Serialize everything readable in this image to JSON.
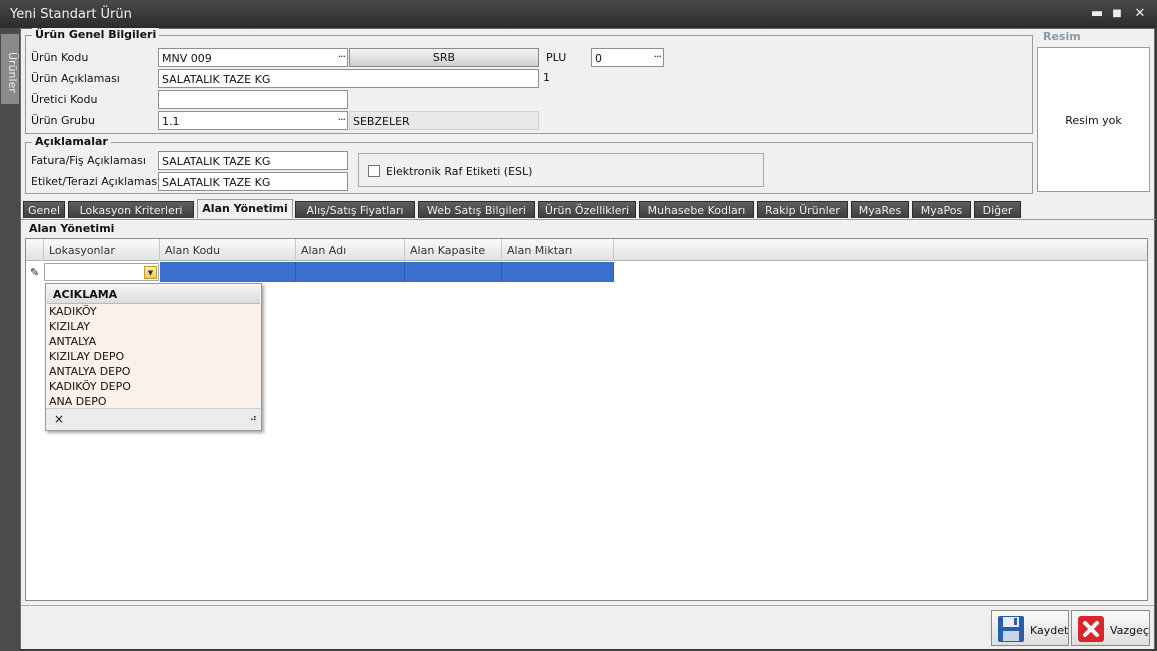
{
  "window": {
    "title": "Yeni Standart Ürün",
    "minimize": "▬",
    "maximize": "■",
    "close": "✕"
  },
  "side_tab": {
    "label": "Ürünler"
  },
  "general": {
    "title": "Ürün Genel Bilgileri",
    "product_code_label": "Ürün Kodu",
    "product_code_value": "MNV 009",
    "srb_button": "SRB",
    "plu_label": "PLU",
    "plu_value": "0",
    "description_label": "Ürün Açıklaması",
    "description_value": "SALATALIK TAZE KG",
    "description_count": "1",
    "manufacturer_code_label": "Üretici Kodu",
    "manufacturer_code_value": "",
    "product_group_label": "Ürün Grubu",
    "product_group_value": "1.1",
    "product_group_name": "SEBZELER"
  },
  "descriptions": {
    "title": "Açıklamalar",
    "invoice_label": "Fatura/Fiş Açıklaması",
    "invoice_value": "SALATALIK TAZE KG",
    "scale_label": "Etiket/Terazi Açıklaması",
    "scale_value": "SALATALIK TAZE KG",
    "esl_label": "Elektronik Raf Etiketi (ESL)"
  },
  "image": {
    "title": "Resim",
    "empty_text": "Resim yok"
  },
  "ellipsis": "···",
  "tabs": [
    {
      "label": "Genel"
    },
    {
      "label": "Lokasyon Kriterleri"
    },
    {
      "label": "Alan Yönetimi"
    },
    {
      "label": "Alış/Satış Fiyatları"
    },
    {
      "label": "Web Satış Bilgileri"
    },
    {
      "label": "Ürün Özellikleri"
    },
    {
      "label": "Muhasebe Kodları"
    },
    {
      "label": "Rakip Ürünler"
    },
    {
      "label": "MyaRes"
    },
    {
      "label": "MyaPos"
    },
    {
      "label": "Diğer"
    }
  ],
  "panel": {
    "title": "Alan Yönetimi"
  },
  "grid": {
    "columns": [
      "Lokasyonlar",
      "Alan Kodu",
      "Alan Adı",
      "Alan Kapasite",
      "Alan Miktarı"
    ],
    "row_indicator": "✎"
  },
  "dropdown": {
    "header": "ACIKLAMA",
    "items": [
      "KADIKÖY",
      "KIZILAY",
      "ANTALYA",
      "KIZILAY DEPO",
      "ANTALYA DEPO",
      "KADIKÖY DEPO",
      "ANA DEPO"
    ],
    "clear_label": "×",
    "resize_grip": "⠴"
  },
  "footer": {
    "save_label": "Kaydet",
    "cancel_label": "Vazgeç"
  },
  "colors": {
    "accent": "#3b6fcf",
    "titlebar": "#2c2c2c",
    "popup_bg": "#fbf1e8"
  }
}
